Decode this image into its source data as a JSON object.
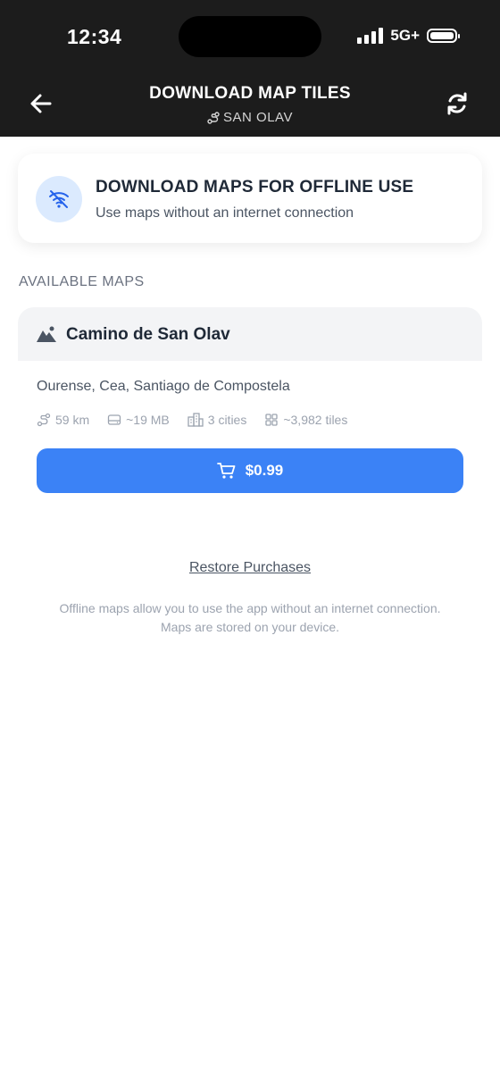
{
  "status_bar": {
    "time": "12:34",
    "network": "5G+"
  },
  "header": {
    "title": "DOWNLOAD MAP TILES",
    "subtitle": "SAN OLAV"
  },
  "offline_card": {
    "title": "DOWNLOAD MAPS FOR OFFLINE USE",
    "subtitle": "Use maps without an internet connection"
  },
  "section": {
    "label": "AVAILABLE MAPS"
  },
  "map": {
    "name": "Camino de San Olav",
    "route": "Ourense, Cea, Santiago de Compostela",
    "distance": "59 km",
    "size": "~19 MB",
    "cities": "3 cities",
    "tiles": "~3,982 tiles",
    "price": "$0.99"
  },
  "restore_label": "Restore Purchases",
  "footnote": {
    "line1": "Offline maps allow you to use the app without an internet connection.",
    "line2": "Maps are stored on your device."
  },
  "colors": {
    "accent": "#3b82f6",
    "header_bg": "#1c1c1c"
  }
}
